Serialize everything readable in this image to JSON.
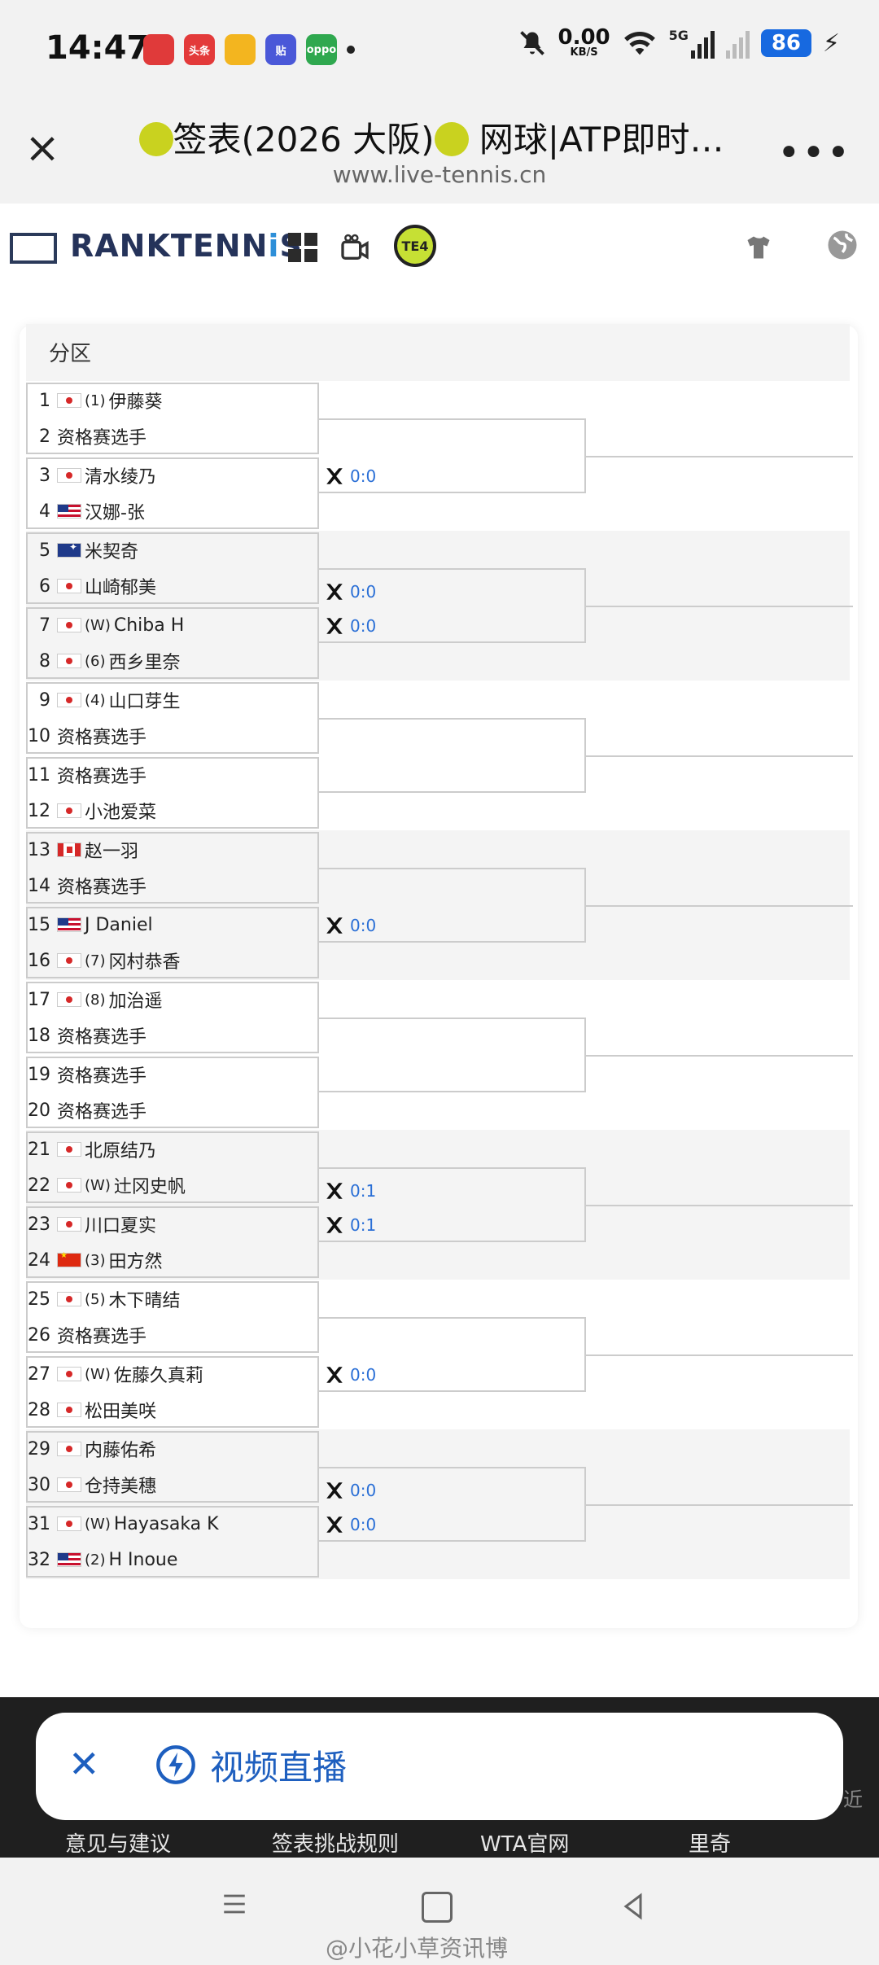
{
  "status_bar": {
    "time": "14:47",
    "apps": [
      {
        "name": "app-red-heart",
        "label": "",
        "color": "#e03a3a"
      },
      {
        "name": "toutiao",
        "label": "头条",
        "color": "#e33a3a"
      },
      {
        "name": "weibo",
        "label": "",
        "color": "#f3b51f"
      },
      {
        "name": "tie",
        "label": "贴",
        "color": "#4a58d8"
      },
      {
        "name": "oppo",
        "label": "oppo",
        "color": "#2fa84f"
      }
    ],
    "net_speed": "0.00",
    "net_unit": "KB/S",
    "signal_label": "5G",
    "battery": "86"
  },
  "browser": {
    "title": "签表(2026 大阪)",
    "title_suffix": " 网球|ATP即时…",
    "url": "www.live-tennis.cn"
  },
  "site": {
    "logo_prefix": "RANKTENN",
    "logo_i": "i",
    "logo_suffix": "S",
    "te4": "TE4"
  },
  "draw": {
    "section_label": "分区",
    "players": [
      {
        "num": "1",
        "flag": "jp",
        "seed": "(1)",
        "name": "伊藤葵"
      },
      {
        "num": "2",
        "flag": "",
        "seed": "",
        "name": "资格赛选手"
      },
      {
        "num": "3",
        "flag": "jp",
        "seed": "",
        "name": "清水绫乃"
      },
      {
        "num": "4",
        "flag": "us",
        "seed": "",
        "name": "汉娜-张"
      },
      {
        "num": "5",
        "flag": "au",
        "seed": "",
        "name": "米契奇"
      },
      {
        "num": "6",
        "flag": "jp",
        "seed": "",
        "name": "山崎郁美"
      },
      {
        "num": "7",
        "flag": "jp",
        "seed": "(W)",
        "name": "Chiba H"
      },
      {
        "num": "8",
        "flag": "jp",
        "seed": "(6)",
        "name": "西乡里奈"
      },
      {
        "num": "9",
        "flag": "jp",
        "seed": "(4)",
        "name": "山口芽生"
      },
      {
        "num": "10",
        "flag": "",
        "seed": "",
        "name": "资格赛选手"
      },
      {
        "num": "11",
        "flag": "",
        "seed": "",
        "name": "资格赛选手"
      },
      {
        "num": "12",
        "flag": "jp",
        "seed": "",
        "name": "小池爱菜"
      },
      {
        "num": "13",
        "flag": "ca",
        "seed": "",
        "name": "赵一羽"
      },
      {
        "num": "14",
        "flag": "",
        "seed": "",
        "name": "资格赛选手"
      },
      {
        "num": "15",
        "flag": "us",
        "seed": "",
        "name": "J Daniel"
      },
      {
        "num": "16",
        "flag": "jp",
        "seed": "(7)",
        "name": "冈村恭香"
      },
      {
        "num": "17",
        "flag": "jp",
        "seed": "(8)",
        "name": "加治遥"
      },
      {
        "num": "18",
        "flag": "",
        "seed": "",
        "name": "资格赛选手"
      },
      {
        "num": "19",
        "flag": "",
        "seed": "",
        "name": "资格赛选手"
      },
      {
        "num": "20",
        "flag": "",
        "seed": "",
        "name": "资格赛选手"
      },
      {
        "num": "21",
        "flag": "jp",
        "seed": "",
        "name": "北原结乃"
      },
      {
        "num": "22",
        "flag": "jp",
        "seed": "(W)",
        "name": "辻冈史帆"
      },
      {
        "num": "23",
        "flag": "jp",
        "seed": "",
        "name": "川口夏实"
      },
      {
        "num": "24",
        "flag": "cn",
        "seed": "(3)",
        "name": "田方然"
      },
      {
        "num": "25",
        "flag": "jp",
        "seed": "(5)",
        "name": "木下晴结"
      },
      {
        "num": "26",
        "flag": "",
        "seed": "",
        "name": "资格赛选手"
      },
      {
        "num": "27",
        "flag": "jp",
        "seed": "(W)",
        "name": "佐藤久真莉"
      },
      {
        "num": "28",
        "flag": "jp",
        "seed": "",
        "name": "松田美咲"
      },
      {
        "num": "29",
        "flag": "jp",
        "seed": "",
        "name": "内藤佑希"
      },
      {
        "num": "30",
        "flag": "jp",
        "seed": "",
        "name": "仓持美穗"
      },
      {
        "num": "31",
        "flag": "jp",
        "seed": "(W)",
        "name": "Hayasaka K"
      },
      {
        "num": "32",
        "flag": "us",
        "seed": "(2)",
        "name": "H Inoue"
      }
    ],
    "scores": [
      {
        "match": 1,
        "score": ""
      },
      {
        "match": 2,
        "score": "0:0"
      },
      {
        "match": 3,
        "score": "0:0"
      },
      {
        "match": 4,
        "score": "0:0"
      },
      {
        "match": 5,
        "score": ""
      },
      {
        "match": 6,
        "score": ""
      },
      {
        "match": 7,
        "score": ""
      },
      {
        "match": 8,
        "score": "0:0"
      },
      {
        "match": 9,
        "score": ""
      },
      {
        "match": 10,
        "score": ""
      },
      {
        "match": 11,
        "score": "0:1"
      },
      {
        "match": 12,
        "score": "0:1"
      },
      {
        "match": 13,
        "score": ""
      },
      {
        "match": 14,
        "score": "0:0"
      },
      {
        "match": 15,
        "score": "0:0"
      },
      {
        "match": 16,
        "score": "0:0"
      }
    ]
  },
  "footer": {
    "links": [
      "意见与建议",
      "签表挑战规则",
      "WTA官网",
      "里奇"
    ],
    "peek": "近"
  },
  "popup": {
    "label": "视频直播"
  },
  "watermark": "@小花小草资讯博"
}
